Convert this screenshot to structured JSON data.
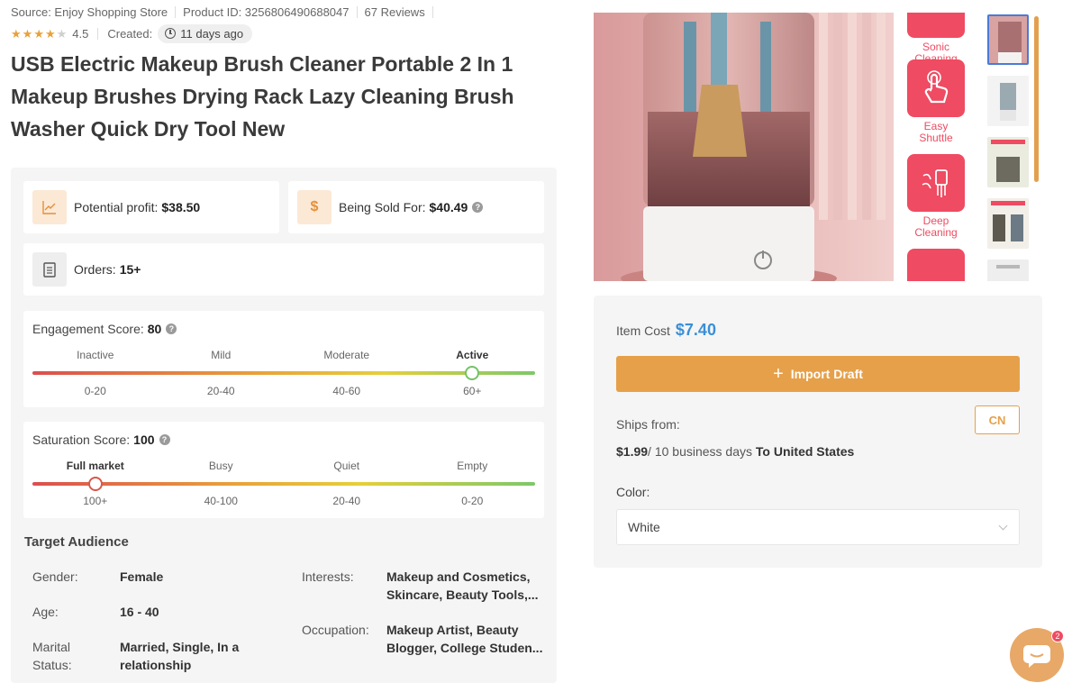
{
  "meta": {
    "source": "Source: Enjoy Shopping Store",
    "product_id": "Product ID: 3256806490688047",
    "reviews": "67 Reviews",
    "rating": "4.5",
    "created_label": "Created:",
    "created_value": "11 days ago"
  },
  "title": "USB Electric Makeup Brush Cleaner Portable 2 In 1 Makeup Brushes Drying Rack Lazy Cleaning Brush Washer Quick Dry Tool New",
  "stats": {
    "profit_label": "Potential profit:",
    "profit_value": "$38.50",
    "sold_label": "Being Sold For:",
    "sold_value": "$40.49",
    "orders_label": "Orders:",
    "orders_value": "15+",
    "dollar_symbol": "$"
  },
  "engagement": {
    "label": "Engagement Score:",
    "value": "80",
    "levels": [
      "Inactive",
      "Mild",
      "Moderate",
      "Active"
    ],
    "ranges": [
      "0-20",
      "20-40",
      "40-60",
      "60+"
    ],
    "active_index": 3,
    "indicator_position": 0.875
  },
  "saturation": {
    "label": "Saturation Score:",
    "value": "100",
    "levels": [
      "Full market",
      "Busy",
      "Quiet",
      "Empty"
    ],
    "ranges": [
      "100+",
      "40-100",
      "20-40",
      "0-20"
    ],
    "active_index": 0,
    "indicator_position": 0.125
  },
  "audience": {
    "title": "Target Audience",
    "gender_label": "Gender:",
    "gender_value": "Female",
    "age_label": "Age:",
    "age_value": "16 - 40",
    "marital_label_1": "Marital",
    "marital_label_2": "Status:",
    "marital_value_1": "Married, Single, In a",
    "marital_value_2": "relationship",
    "interests_label": "Interests:",
    "interests_value_1": "Makeup and Cosmetics,",
    "interests_value_2": "Skincare, Beauty Tools,...",
    "occupation_label": "Occupation:",
    "occupation_value_1": "Makeup Artist, Beauty",
    "occupation_value_2": "Blogger, College Studen..."
  },
  "features": [
    {
      "line1": "Sonic",
      "line2": "Cleaning",
      "icon": "sonic-icon"
    },
    {
      "line1": "Easy",
      "line2": "Shuttle",
      "icon": "hand-tap-icon"
    },
    {
      "line1": "Deep",
      "line2": "Cleaning",
      "icon": "brush-icon"
    }
  ],
  "purchase": {
    "item_cost_label": "Item Cost",
    "item_cost_value": "$7.40",
    "import_label": "Import Draft",
    "ships_from_label": "Ships from:",
    "ships_from_value": "CN",
    "shipping_price": "$1.99",
    "shipping_days": "/ 10 business days",
    "shipping_dest": "To United States",
    "color_label": "Color:",
    "color_value": "White"
  },
  "chat": {
    "badge": "2"
  },
  "colors": {
    "accent": "#e6a04a",
    "price_blue": "#3a8fd6",
    "feature_red": "#ef4b62",
    "star": "#e9a13a"
  }
}
